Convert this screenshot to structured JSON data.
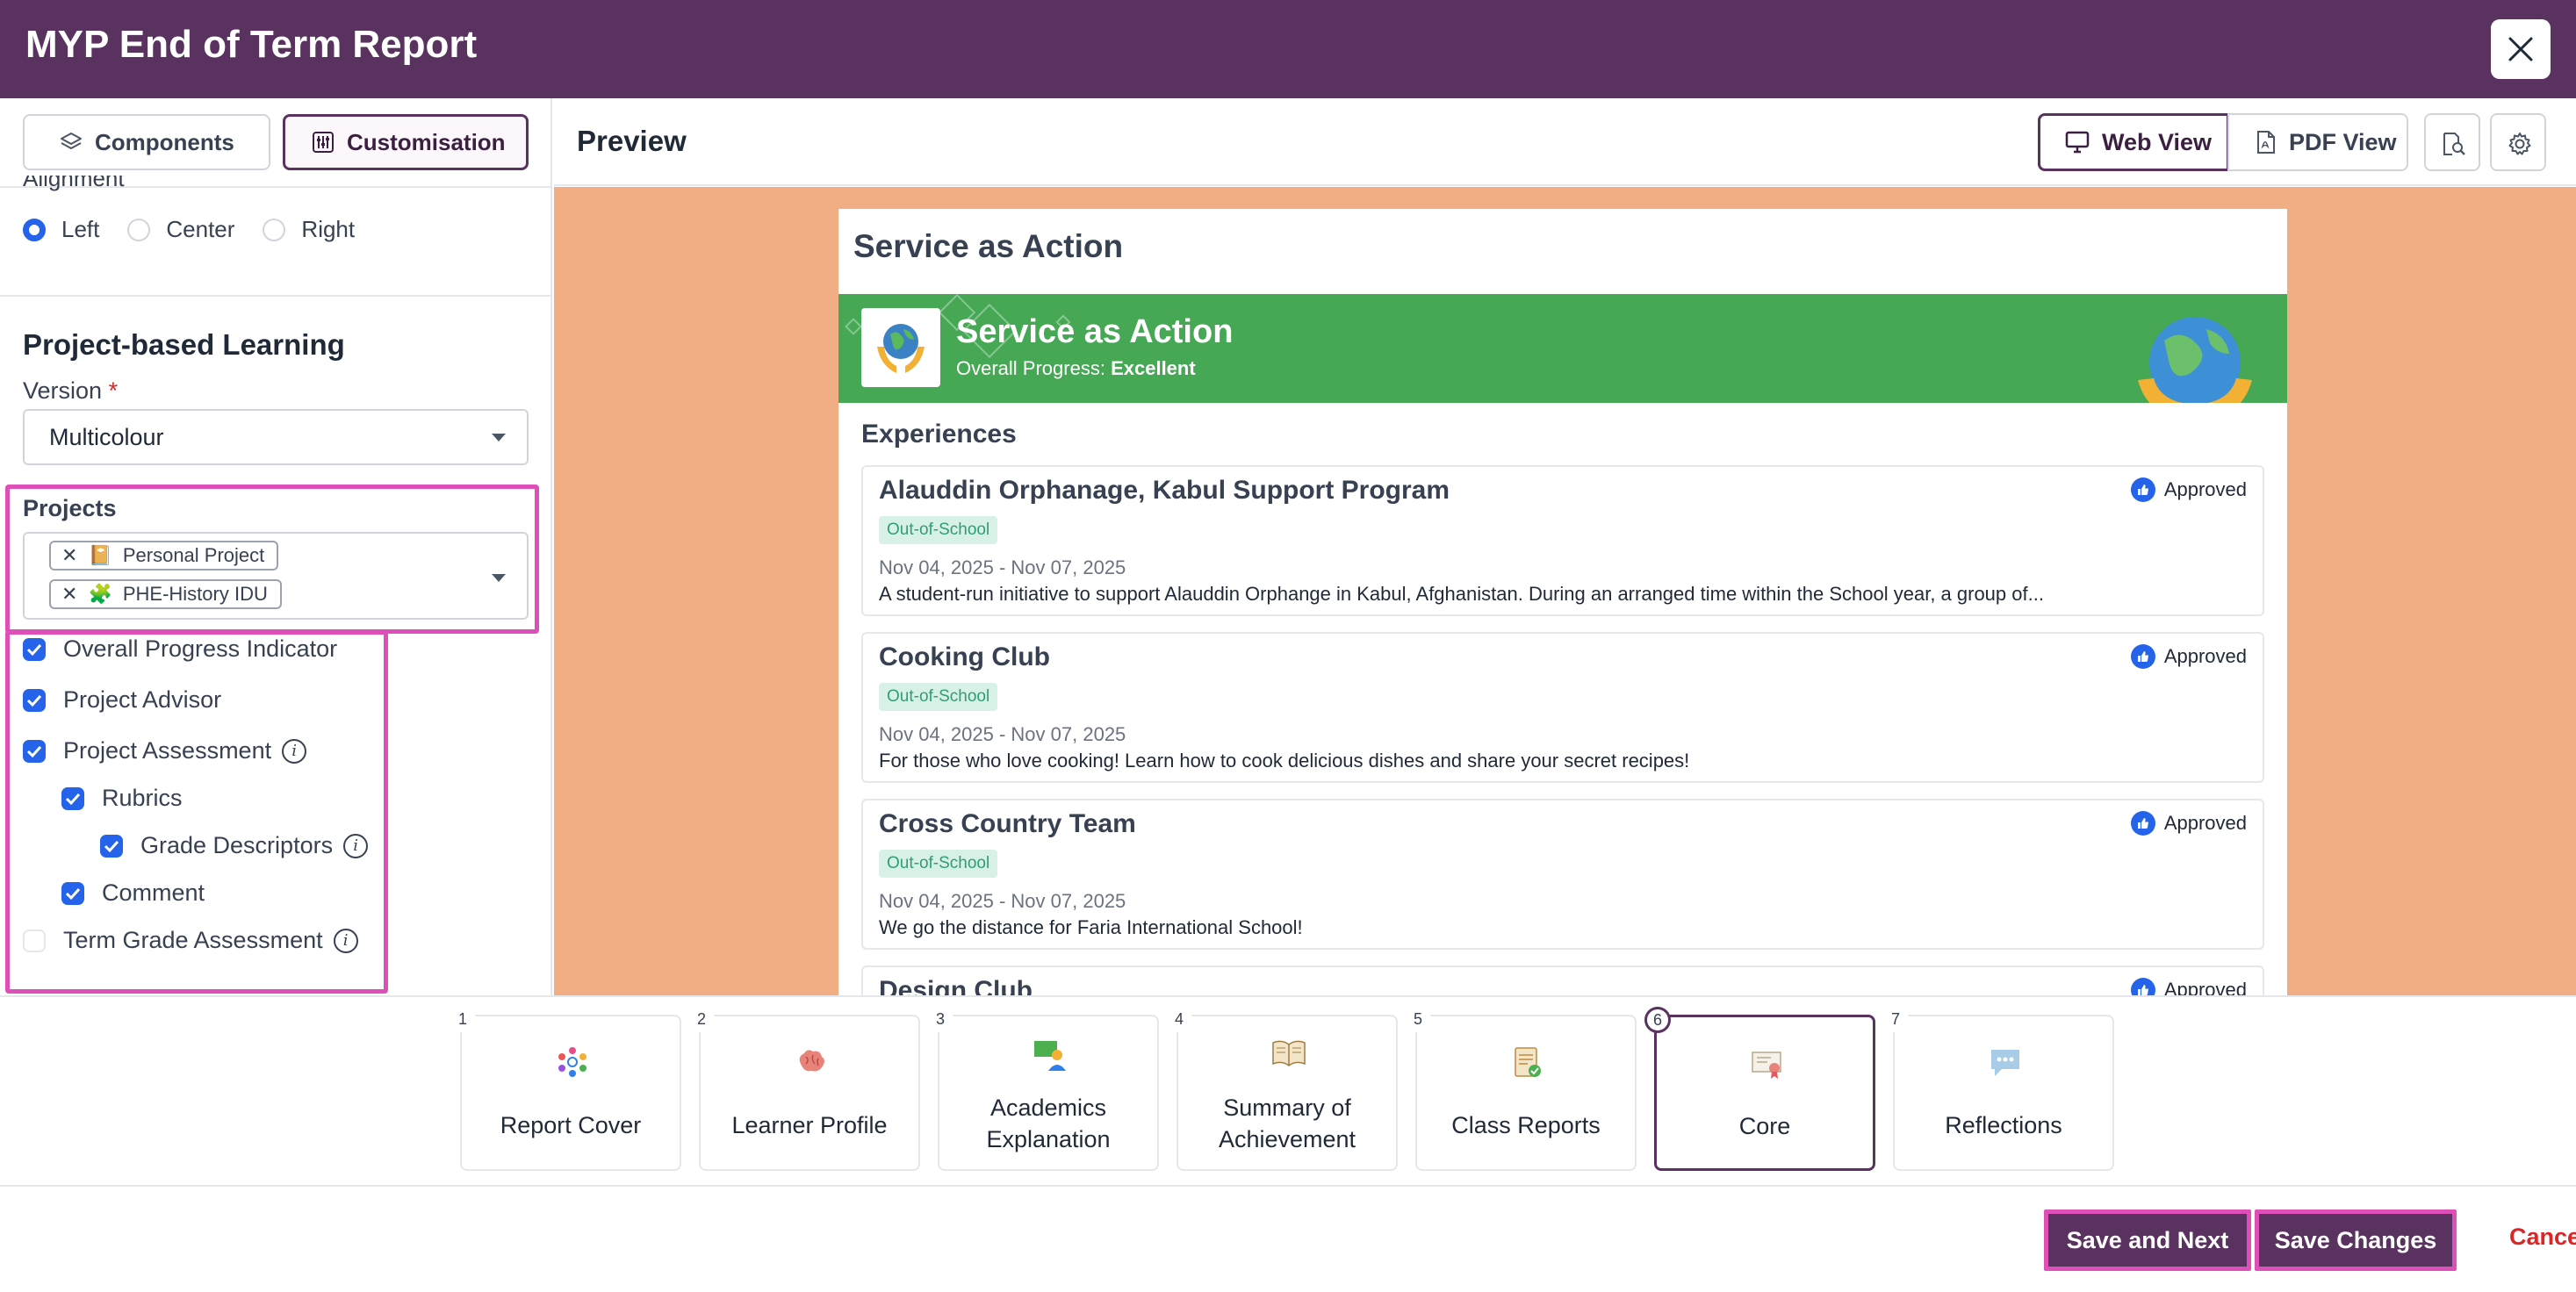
{
  "header": {
    "title": "MYP End of Term Report"
  },
  "left": {
    "tabs": {
      "components": "Components",
      "customisation": "Customisation"
    },
    "alignment": {
      "label": "Alignment",
      "options": [
        "Left",
        "Center",
        "Right"
      ],
      "selected": "Left"
    },
    "pbl": {
      "title": "Project-based Learning",
      "version_label": "Version",
      "required_mark": "*",
      "version_value": "Multicolour",
      "projects_label": "Projects",
      "projects": [
        {
          "remove": "✕",
          "icon": "📔",
          "label": "Personal Project"
        },
        {
          "remove": "✕",
          "icon": "🧩",
          "label": "PHE-History IDU"
        }
      ],
      "options": [
        {
          "label": "Overall Progress Indicator",
          "checked": true
        },
        {
          "label": "Project Advisor",
          "checked": true
        },
        {
          "label": "Project Assessment",
          "checked": true,
          "info": "i"
        },
        {
          "label": "Rubrics",
          "checked": true
        },
        {
          "label": "Grade Descriptors",
          "checked": true,
          "info": "i"
        },
        {
          "label": "Comment",
          "checked": true
        },
        {
          "label": "Term Grade Assessment",
          "checked": false,
          "info": "i"
        }
      ]
    }
  },
  "preview": {
    "title": "Preview",
    "web_view": "Web View",
    "pdf_view": "PDF View",
    "paper_title": "Service as Action",
    "banner": {
      "title": "Service as Action",
      "progress_prefix": "Overall Progress:",
      "progress_value": "Excellent",
      "color": "#46a854"
    },
    "experiences_title": "Experiences",
    "cards": [
      {
        "title": "Alauddin Orphanage, Kabul Support Program",
        "badge": "Out-of-School",
        "date": "Nov 04, 2025 - Nov 07, 2025",
        "desc": "A student-run initiative to support Alauddin Orphange in Kabul, Afghanistan. During an arranged time within the School year, a group of...",
        "status": "Approved"
      },
      {
        "title": "Cooking Club",
        "badge": "Out-of-School",
        "date": "Nov 04, 2025 - Nov 07, 2025",
        "desc": "For those who love cooking! Learn how to cook delicious dishes and share your secret recipes!",
        "status": "Approved"
      },
      {
        "title": "Cross Country Team",
        "badge": "Out-of-School",
        "date": "Nov 04, 2025 - Nov 07, 2025",
        "desc": "We go the distance for Faria International School!",
        "status": "Approved"
      },
      {
        "title": "Design Club",
        "badge": "",
        "date": "",
        "desc": "",
        "status": "Approved"
      }
    ]
  },
  "steps": [
    {
      "num": "1",
      "label1": "Report Cover",
      "label2": "",
      "icon": "people-circle-icon"
    },
    {
      "num": "2",
      "label1": "Learner Profile",
      "label2": "",
      "icon": "brain-icon"
    },
    {
      "num": "3",
      "label1": "Academics",
      "label2": "Explanation",
      "icon": "teacher-board-icon"
    },
    {
      "num": "4",
      "label1": "Summary of",
      "label2": "Achievement",
      "icon": "open-book-icon"
    },
    {
      "num": "5",
      "label1": "Class Reports",
      "label2": "",
      "icon": "clipboard-check-icon"
    },
    {
      "num": "6",
      "label1": "Core",
      "label2": "",
      "icon": "certificate-icon",
      "active": true
    },
    {
      "num": "7",
      "label1": "Reflections",
      "label2": "",
      "icon": "speech-bubble-icon"
    }
  ],
  "footer": {
    "save_next": "Save and Next",
    "save_changes": "Save Changes",
    "cancel": "Cancel"
  },
  "colors": {
    "brand": "#5a3260",
    "highlight": "#de4fb8",
    "preview_bg": "#f1ae84",
    "accent": "#2563eb"
  }
}
